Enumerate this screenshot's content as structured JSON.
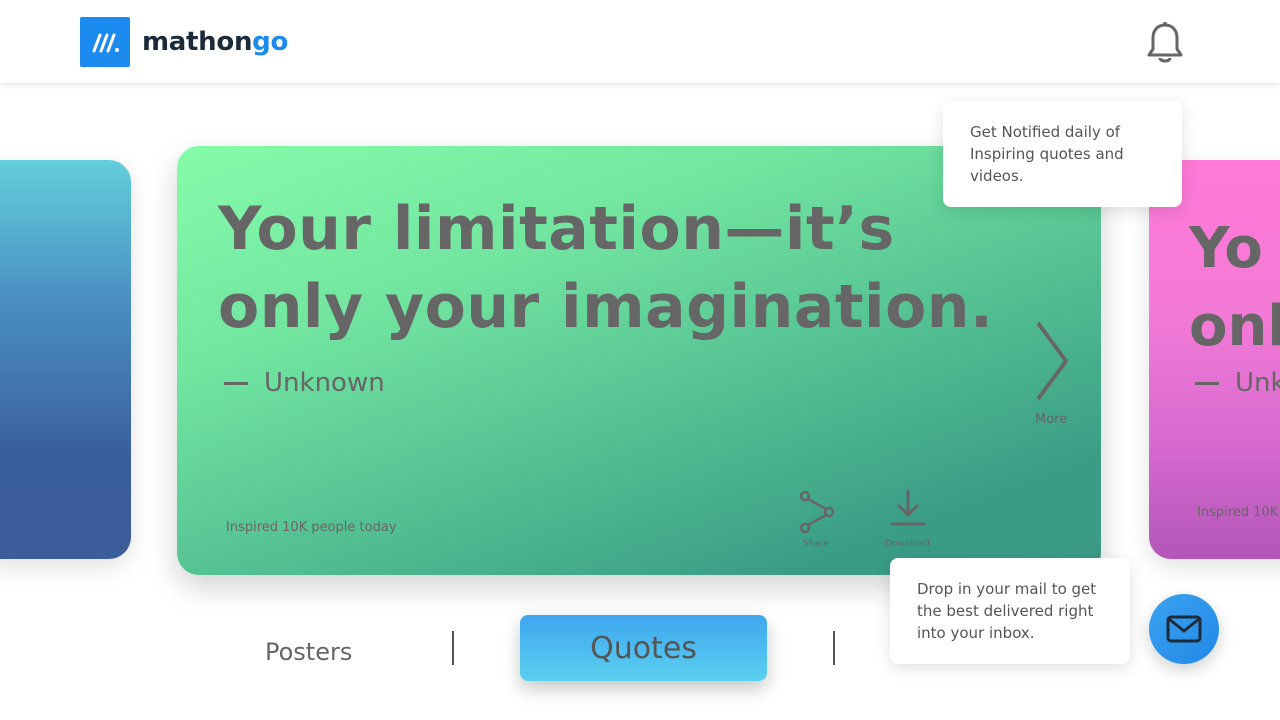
{
  "header": {
    "logo_text_main": "mathon",
    "logo_text_accent": "go",
    "logo_icon": "mathongo-logo-icon",
    "bell_icon": "bell-icon"
  },
  "cards": {
    "main": {
      "quote_line1": "Your limitation—it’s",
      "quote_line2": "only your imagination.",
      "author": "Unknown",
      "inspired": "Inspired 10K people today",
      "more_label": "More",
      "share_label": "Share",
      "download_label": "Download"
    },
    "right_peek": {
      "quote_line1": "Yo",
      "quote_line2": "onl",
      "author": "Unk",
      "inspired": "Inspired 10K"
    }
  },
  "tooltips": {
    "notify": "Get Notified daily of Inspiring quotes and videos.",
    "mail": "Drop in your mail to get the best delivered right into your inbox."
  },
  "tabs": {
    "posters": "Posters",
    "quotes": "Quotes"
  },
  "colors": {
    "brand_blue": "#1c8bef",
    "card_main_top": "#86fbaa",
    "card_main_bottom": "#3b9a86",
    "card_right": "#ff7ad6",
    "card_left": "#3c5c9a"
  }
}
